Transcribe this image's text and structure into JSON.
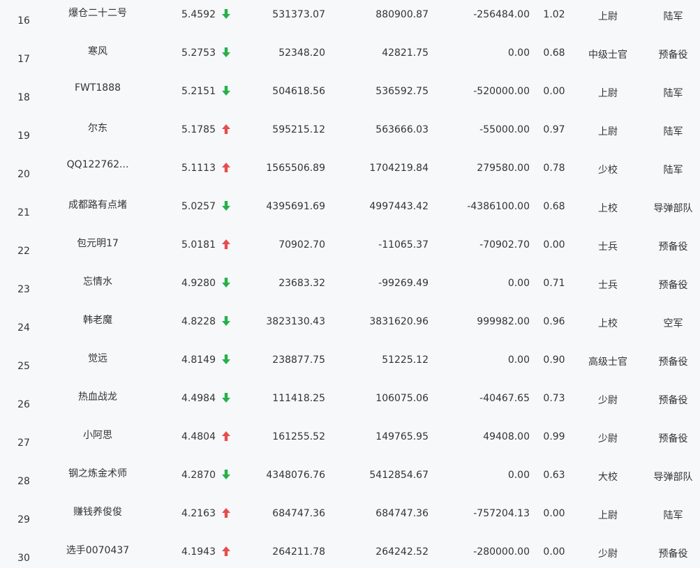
{
  "colors": {
    "background": "#f7f8fa",
    "text": "#333333",
    "up": "#e84c4c",
    "down": "#27b04a"
  },
  "rows": [
    {
      "rank": "16",
      "name": "爆仓二十二号",
      "score": "5.4592",
      "trend": "down",
      "v1": "531373.07",
      "v2": "880900.87",
      "v3": "-256484.00",
      "ratio": "1.02",
      "military_rank": "上尉",
      "branch": "陆军"
    },
    {
      "rank": "17",
      "name": "寒风",
      "score": "5.2753",
      "trend": "down",
      "v1": "52348.20",
      "v2": "42821.75",
      "v3": "0.00",
      "ratio": "0.68",
      "military_rank": "中级士官",
      "branch": "预备役"
    },
    {
      "rank": "18",
      "name": "FWT1888",
      "score": "5.2151",
      "trend": "down",
      "v1": "504618.56",
      "v2": "536592.75",
      "v3": "-520000.00",
      "ratio": "0.00",
      "military_rank": "上尉",
      "branch": "陆军"
    },
    {
      "rank": "19",
      "name": "尔东",
      "score": "5.1785",
      "trend": "up",
      "v1": "595215.12",
      "v2": "563666.03",
      "v3": "-55000.00",
      "ratio": "0.97",
      "military_rank": "上尉",
      "branch": "陆军"
    },
    {
      "rank": "20",
      "name": "QQ122762...",
      "score": "5.1113",
      "trend": "up",
      "v1": "1565506.89",
      "v2": "1704219.84",
      "v3": "279580.00",
      "ratio": "0.78",
      "military_rank": "少校",
      "branch": "陆军"
    },
    {
      "rank": "21",
      "name": "成都路有点堵",
      "score": "5.0257",
      "trend": "down",
      "v1": "4395691.69",
      "v2": "4997443.42",
      "v3": "-4386100.00",
      "ratio": "0.68",
      "military_rank": "上校",
      "branch": "导弹部队"
    },
    {
      "rank": "22",
      "name": "包元明17",
      "score": "5.0181",
      "trend": "up",
      "v1": "70902.70",
      "v2": "-11065.37",
      "v3": "-70902.70",
      "ratio": "0.00",
      "military_rank": "士兵",
      "branch": "预备役"
    },
    {
      "rank": "23",
      "name": "忘情水",
      "score": "4.9280",
      "trend": "down",
      "v1": "23683.32",
      "v2": "-99269.49",
      "v3": "0.00",
      "ratio": "0.71",
      "military_rank": "士兵",
      "branch": "预备役"
    },
    {
      "rank": "24",
      "name": "韩老魔",
      "score": "4.8228",
      "trend": "down",
      "v1": "3823130.43",
      "v2": "3831620.96",
      "v3": "999982.00",
      "ratio": "0.96",
      "military_rank": "上校",
      "branch": "空军"
    },
    {
      "rank": "25",
      "name": "觉远",
      "score": "4.8149",
      "trend": "down",
      "v1": "238877.75",
      "v2": "51225.12",
      "v3": "0.00",
      "ratio": "0.90",
      "military_rank": "高级士官",
      "branch": "预备役"
    },
    {
      "rank": "26",
      "name": "热血战龙",
      "score": "4.4984",
      "trend": "down",
      "v1": "111418.25",
      "v2": "106075.06",
      "v3": "-40467.65",
      "ratio": "0.73",
      "military_rank": "少尉",
      "branch": "预备役"
    },
    {
      "rank": "27",
      "name": "小阿思",
      "score": "4.4804",
      "trend": "up",
      "v1": "161255.52",
      "v2": "149765.95",
      "v3": "49408.00",
      "ratio": "0.99",
      "military_rank": "少尉",
      "branch": "预备役"
    },
    {
      "rank": "28",
      "name": "钢之炼金术师",
      "score": "4.2870",
      "trend": "down",
      "v1": "4348076.76",
      "v2": "5412854.67",
      "v3": "0.00",
      "ratio": "0.63",
      "military_rank": "大校",
      "branch": "导弹部队"
    },
    {
      "rank": "29",
      "name": "赚钱养俊俊",
      "score": "4.2163",
      "trend": "up",
      "v1": "684747.36",
      "v2": "684747.36",
      "v3": "-757204.13",
      "ratio": "0.00",
      "military_rank": "上尉",
      "branch": "陆军"
    },
    {
      "rank": "30",
      "name": "选手0070437",
      "score": "4.1943",
      "trend": "up",
      "v1": "264211.78",
      "v2": "264242.52",
      "v3": "-280000.00",
      "ratio": "0.00",
      "military_rank": "少尉",
      "branch": "预备役"
    }
  ]
}
